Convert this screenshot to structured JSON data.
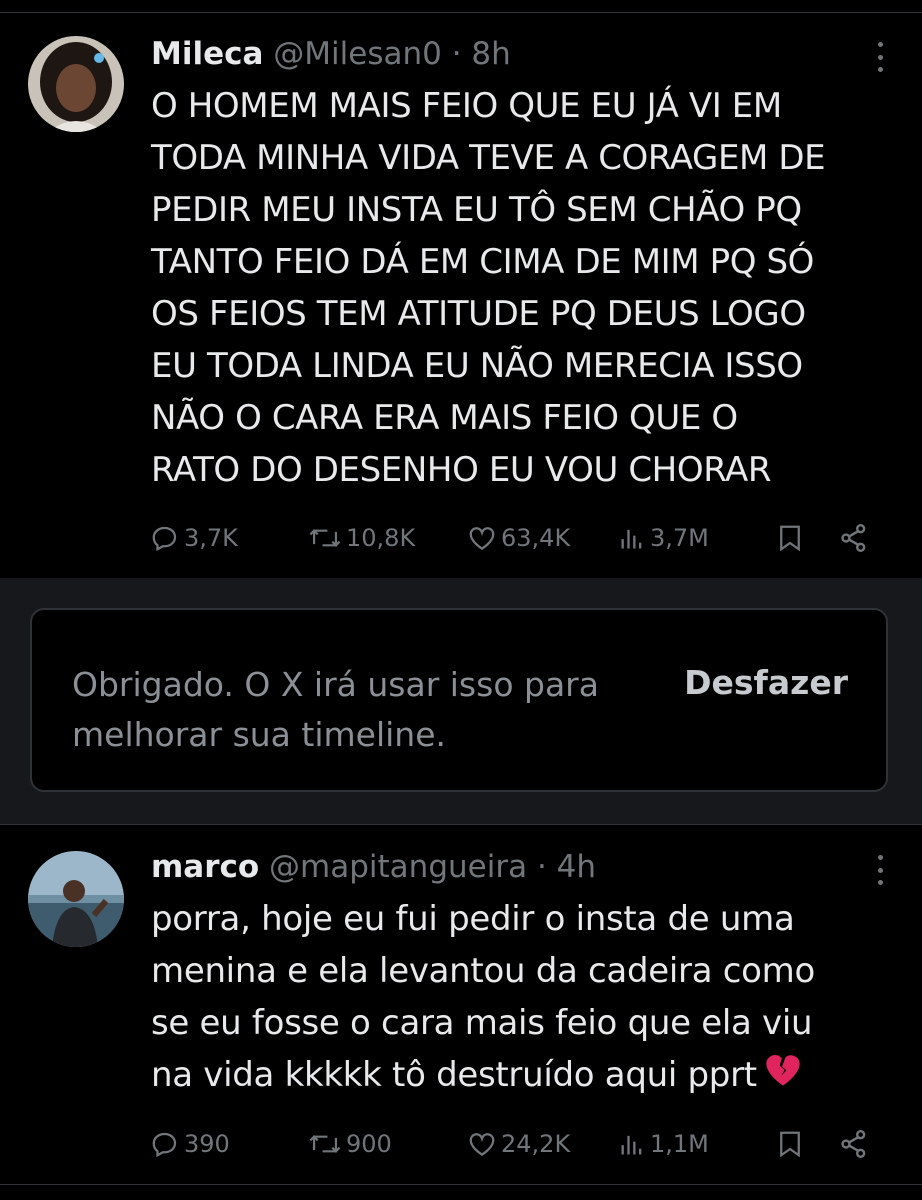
{
  "posts": [
    {
      "name": "Mileca",
      "handle": "@Milesan0",
      "dot": "·",
      "time": "8h",
      "text": "O HOMEM MAIS FEIO QUE EU JÁ VI EM\nTODA MINHA VIDA TEVE A CORAGEM DE\nPEDIR MEU INSTA EU TÔ SEM CHÃO PQ\nTANTO FEIO DÁ EM CIMA DE MIM PQ SÓ\nOS FEIOS TEM ATITUDE PQ DEUS LOGO\nEU TODA LINDA EU NÃO MERECIA ISSO\nNÃO O CARA ERA MAIS FEIO QUE O\nRATO DO DESENHO EU VOU CHORAR",
      "replies": "3,7K",
      "reposts": "10,8K",
      "likes": "63,4K",
      "views": "3,7M"
    },
    {
      "name": "marco",
      "handle": "@mapitangueira",
      "dot": "·",
      "time": "4h",
      "text": "porra, hoje eu fui pedir o insta de uma\nmenina e ela levantou da cadeira como\nse eu fosse o cara mais feio que ela viu\nna vida kkkkk tô destruído aqui pprt",
      "replies": "390",
      "reposts": "900",
      "likes": "24,2K",
      "views": "1,1M"
    }
  ],
  "notice": {
    "text": "Obrigado. O X irá usar isso para melhorar sua timeline.",
    "undo_label": "Desfazer"
  },
  "icons": {
    "reply": "reply-icon",
    "repost": "repost-icon",
    "like": "heart-icon",
    "views": "views-icon",
    "bookmark": "bookmark-icon",
    "share": "share-icon",
    "emoji": "broken-heart-icon"
  },
  "colors": {
    "background": "#000000",
    "text": "#e7e9ea",
    "muted": "#71767b",
    "separator": "#16181c",
    "emoji": "#e0245e"
  }
}
